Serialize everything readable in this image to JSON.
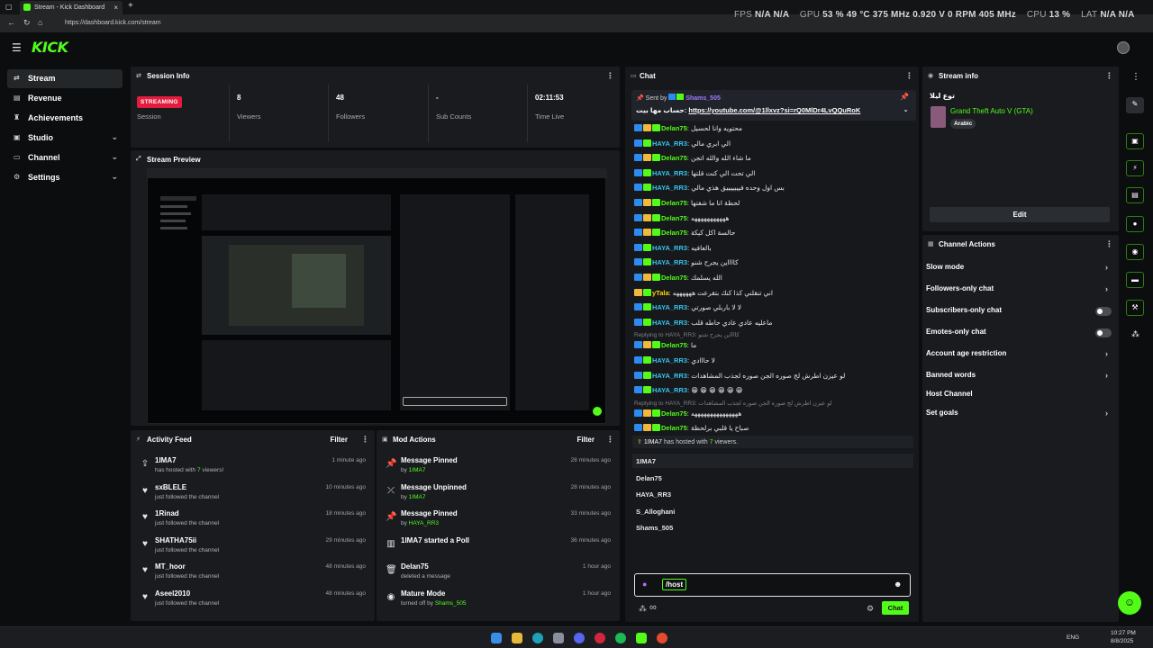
{
  "browser": {
    "tab_title": "Stream - Kick Dashboard",
    "url": "https://dashboard.kick.com/stream"
  },
  "overlay": {
    "fps_label": "FPS",
    "fps_values": "N/A  N/A",
    "gpu_label": "GPU",
    "gpu_values": "53 %  49 °C  375 MHz  0.920 V  0 RPM  405 MHz",
    "cpu_label": "CPU",
    "cpu_values": "13 %",
    "lat_label": "LAT",
    "lat_values": "N/A  N/A"
  },
  "brand": {
    "logo": "KICK"
  },
  "sidebar": {
    "items": [
      {
        "label": "Stream",
        "icon": "stream-icon"
      },
      {
        "label": "Revenue",
        "icon": "revenue-icon"
      },
      {
        "label": "Achievements",
        "icon": "trophy-icon"
      },
      {
        "label": "Studio",
        "icon": "studio-icon"
      },
      {
        "label": "Channel",
        "icon": "channel-icon"
      },
      {
        "label": "Settings",
        "icon": "gear-icon"
      }
    ]
  },
  "session": {
    "title": "Session Info",
    "status": "STREAMING",
    "session_label": "Session",
    "stats": [
      {
        "value": "8",
        "label": "Viewers"
      },
      {
        "value": "48",
        "label": "Followers"
      },
      {
        "value": "-",
        "label": "Sub Counts"
      },
      {
        "value": "02:11:53",
        "label": "Time Live"
      }
    ]
  },
  "preview": {
    "title": "Stream Preview"
  },
  "activity": {
    "title": "Activity Feed",
    "filter": "Filter",
    "items": [
      {
        "name": "1IMA7",
        "sub_pre": "has hosted with ",
        "sub_hl": "7",
        "sub_post": " viewers!",
        "time": "1 minute ago",
        "icon": "host-icon"
      },
      {
        "name": "sxBLELE",
        "sub_pre": "just followed the channel",
        "sub_hl": "",
        "sub_post": "",
        "time": "10 minutes ago",
        "icon": "heart-icon"
      },
      {
        "name": "1Rinad",
        "sub_pre": "just followed the channel",
        "sub_hl": "",
        "sub_post": "",
        "time": "18 minutes ago",
        "icon": "heart-icon"
      },
      {
        "name": "SHATHA75ii",
        "sub_pre": "just followed the channel",
        "sub_hl": "",
        "sub_post": "",
        "time": "29 minutes ago",
        "icon": "heart-icon"
      },
      {
        "name": "MT_hoor",
        "sub_pre": "just followed the channel",
        "sub_hl": "",
        "sub_post": "",
        "time": "48 minutes ago",
        "icon": "heart-icon"
      },
      {
        "name": "Aseel2010",
        "sub_pre": "just followed the channel",
        "sub_hl": "",
        "sub_post": "",
        "time": "48 minutes ago",
        "icon": "heart-icon"
      }
    ]
  },
  "modactions": {
    "title": "Mod Actions",
    "filter": "Filter",
    "items": [
      {
        "action": "Message Pinned",
        "by_pre": "by ",
        "by": "1IMA7",
        "time": "28 minutes ago",
        "icon": "pin-icon"
      },
      {
        "action": "Message Unpinned",
        "by_pre": "by ",
        "by": "1IMA7",
        "time": "28 minutes ago",
        "icon": "unpin-icon"
      },
      {
        "action": "Message Pinned",
        "by_pre": "by ",
        "by": "HAYA_RR3",
        "time": "33 minutes ago",
        "icon": "pin-icon"
      },
      {
        "action": "1IMA7 started a Poll",
        "by_pre": "",
        "by": "",
        "time": "36 minutes ago",
        "icon": "poll-icon"
      },
      {
        "action": "Delan75",
        "by_pre": "deleted a message",
        "by": "",
        "time": "1 hour ago",
        "icon": "trash-icon"
      },
      {
        "action": "Mature Mode",
        "by_pre": "turned off by ",
        "by": "Shams_505",
        "time": "1 hour ago",
        "icon": "eye-icon"
      }
    ]
  },
  "chat": {
    "title": "Chat",
    "pinned_by_label": "Sent by",
    "pinned_by": "Shams_505",
    "pinned_text": "حساب مها بيت:",
    "pinned_link": "https://youtube.com/@1llxvz?si=rQ0MlDr4LvQQuRoK",
    "messages": [
      {
        "user": "Delan75",
        "cls": "c2",
        "badges": "mg",
        "text": "محتويه وانا لحسيل"
      },
      {
        "user": "HAYA_RR3",
        "cls": "c1",
        "badges": "m",
        "text": "الي ابري مالي"
      },
      {
        "user": "Delan75",
        "cls": "c2",
        "badges": "mg",
        "text": "ما شاء الله والله اتجن"
      },
      {
        "user": "HAYA_RR3",
        "cls": "c1",
        "badges": "m",
        "text": "الي تحت الي كنت قلتها"
      },
      {
        "user": "HAYA_RR3",
        "cls": "c1",
        "badges": "m",
        "text": "بس اول وحده فيييييييق هذي مالي"
      },
      {
        "user": "Delan75",
        "cls": "c2",
        "badges": "mg",
        "text": "لحظة انا ما شفتها"
      },
      {
        "user": "Delan75",
        "cls": "c2",
        "badges": "mg",
        "text": "هههههههههههه"
      },
      {
        "user": "Delan75",
        "cls": "c2",
        "badges": "mg",
        "text": "حالسة اكل كيكة"
      },
      {
        "user": "HAYA_RR3",
        "cls": "c1",
        "badges": "m",
        "text": "بالعافيه"
      },
      {
        "user": "HAYA_RR3",
        "cls": "c1",
        "badges": "m",
        "text": "كااااين يجرح شنو"
      },
      {
        "user": "Delan75",
        "cls": "c2",
        "badges": "mg",
        "text": "الله يسلمك"
      },
      {
        "user": "yTala",
        "cls": "c3",
        "badges": "g",
        "text": "اني تنقلني كذا كنك بتقرعت ههههههه"
      },
      {
        "user": "HAYA_RR3",
        "cls": "c1",
        "badges": "m",
        "text": "لا لا باربلي صورتي"
      },
      {
        "user": "HAYA_RR3",
        "cls": "c1",
        "badges": "m",
        "text": "ماعليه عادي عادي حاطه قلب"
      }
    ],
    "reply1": "Replying to HAYA_RR3: كااااين يجرح شنو",
    "messages2": [
      {
        "user": "Delan75",
        "cls": "c2",
        "badges": "mg",
        "text": "ما"
      },
      {
        "user": "HAYA_RR3",
        "cls": "c1",
        "badges": "m",
        "text": "لا حااادي"
      },
      {
        "user": "HAYA_RR3",
        "cls": "c1",
        "badges": "m",
        "text": "لو عيزن اطرش لج صوره الجن صوره لجذب المشاهدات"
      },
      {
        "user": "HAYA_RR3",
        "cls": "c1",
        "badges": "m",
        "text": "😁 😁 😁 😁 😁 😁"
      }
    ],
    "reply2": "Replying to HAYA_RR3: لو عيزن اطرش لج صوره الجن صوره لجذب المشاهدات",
    "messages3": [
      {
        "user": "Delan75",
        "cls": "c2",
        "badges": "mg",
        "text": "هههههههههههههههه"
      },
      {
        "user": "Delan75",
        "cls": "c2",
        "badges": "mg",
        "text": "صباح يا قلبي برلحظة"
      }
    ],
    "host_notice_name": "1IMA7",
    "host_notice_mid": " has hosted with ",
    "host_notice_count": "7",
    "host_notice_end": " viewers.",
    "suggestions": [
      "1IMA7",
      "Delan75",
      "HAYA_RR3",
      "S_Alloghani",
      "Shams_505"
    ],
    "input_value": "/host",
    "send_label": "Chat"
  },
  "streaminfo": {
    "title": "Stream info",
    "stream_title": "توع ليلا",
    "category": "Grand Theft Auto V (GTA)",
    "language": "Arabic",
    "edit_label": "Edit"
  },
  "channel_actions": {
    "title": "Channel Actions",
    "rows": [
      {
        "label": "Slow mode",
        "kind": "chevron"
      },
      {
        "label": "Followers-only chat",
        "kind": "chevron"
      },
      {
        "label": "Subscribers-only chat",
        "kind": "toggle"
      },
      {
        "label": "Emotes-only chat",
        "kind": "toggle"
      },
      {
        "label": "Account age restriction",
        "kind": "chevron"
      },
      {
        "label": "Banned words",
        "kind": "chevron"
      },
      {
        "label": "Host Channel",
        "kind": "none"
      },
      {
        "label": "Set goals",
        "kind": "chevron"
      }
    ]
  },
  "taskbar": {
    "lang": "ENG",
    "time": "10:27 PM",
    "date": "8/8/2025"
  },
  "colors": {
    "accent": "#53fc18",
    "live": "#e31b3d",
    "panel": "#191b1f",
    "bg": "#0b0d0e"
  }
}
